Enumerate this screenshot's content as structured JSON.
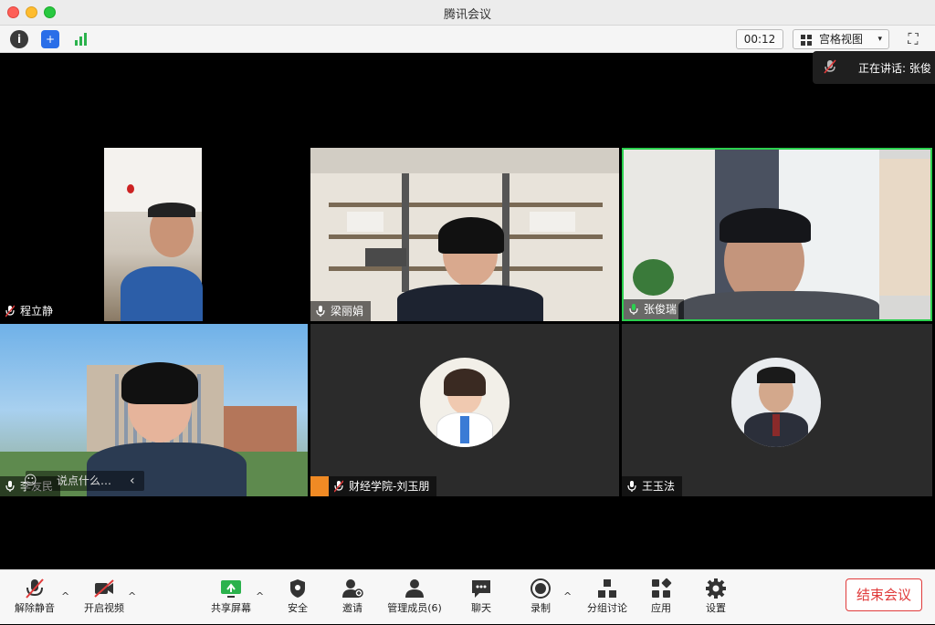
{
  "window": {
    "title": "腾讯会议"
  },
  "toolbar": {
    "info_icon": "info-icon",
    "timer": "00:12",
    "view_label": "宫格视图",
    "view_caret": "▾"
  },
  "speaking": {
    "text": "正在讲话: 张俊"
  },
  "participants": [
    {
      "name": "程立静",
      "muted": true
    },
    {
      "name": "梁丽娟",
      "muted": false
    },
    {
      "name": "张俊瑞",
      "muted": false,
      "active": true
    },
    {
      "name": "李友民",
      "muted": false
    },
    {
      "name": "财经学院-刘玉朋",
      "muted": true
    },
    {
      "name": "王玉法",
      "muted": false
    }
  ],
  "chat": {
    "placeholder": "说点什么…",
    "collapse": "‹"
  },
  "bottombar": {
    "unmute": "解除静音",
    "video": "开启视频",
    "share": "共享屏幕",
    "security": "安全",
    "invite": "邀请",
    "members": "管理成员(6)",
    "chat": "聊天",
    "record": "录制",
    "breakout": "分组讨论",
    "apps": "应用",
    "settings": "设置",
    "end": "结束会议",
    "caret": "^"
  },
  "colors": {
    "active_border": "#2bd04f",
    "end_red": "#e03b3b",
    "mic_green": "#2bd04f"
  }
}
